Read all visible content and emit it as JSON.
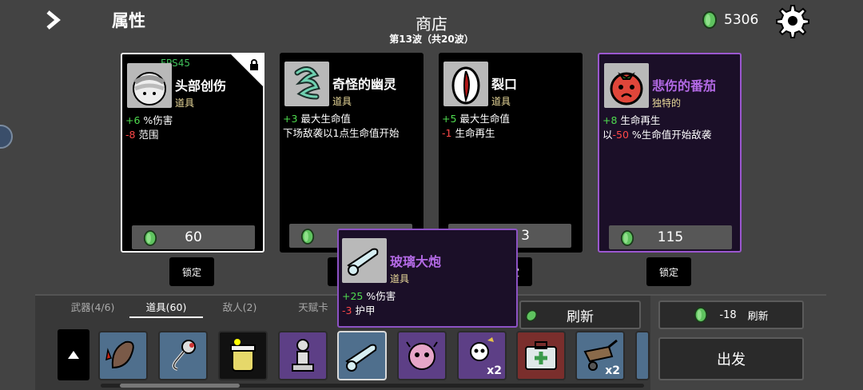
{
  "header": {
    "attributes_title": "属性",
    "shop_title": "商店",
    "wave_text": "第13波（共20波）",
    "money": "5306",
    "fps": "FPS45"
  },
  "colors": {
    "bg": "#434343",
    "positive": "#4fdc4f",
    "negative": "#ff4848",
    "legendary": "#b46ae6",
    "item_type": "#e9d99a",
    "coin": "#5fc35f"
  },
  "cards": [
    {
      "name": "头部创伤",
      "type": "道具",
      "icon": "bandaged-head-icon",
      "stat1_val": "+6",
      "stat1_text": "%伤害",
      "stat2_val": "-8",
      "stat2_text": "范围",
      "price": "60",
      "locked": true
    },
    {
      "name": "奇怪的幽灵",
      "type": "道具",
      "icon": "ghost-icon",
      "stat1_val": "+3",
      "stat1_text": "最大生命值",
      "stat2_text": "下场敌袭以1点生命值开始",
      "price": ""
    },
    {
      "name": "裂口",
      "type": "道具",
      "icon": "wound-mouth-icon",
      "stat1_val": "+5",
      "stat1_text": "最大生命值",
      "stat2_val": "-1",
      "stat2_text": "生命再生",
      "price": "3"
    },
    {
      "name": "悲伤的番茄",
      "type": "独特的",
      "icon": "sad-tomato-icon",
      "stat1_val": "+8",
      "stat1_text": "生命再生",
      "stat2_pre": "以",
      "stat2_val": "-50",
      "stat2_text": "%生命值开始敌袭",
      "price": "115"
    }
  ],
  "lock_label": "锁定",
  "tooltip": {
    "name": "玻璃大炮",
    "type": "道具",
    "icon": "glass-cannon-icon",
    "stat1_val": "+25",
    "stat1_text": "%伤害",
    "stat2_val": "-3",
    "stat2_text": "护甲"
  },
  "tabs": [
    {
      "label": "武器(4/6)",
      "active": false
    },
    {
      "label": "道具(60)",
      "active": true
    },
    {
      "label": "敌人(2)",
      "active": false
    },
    {
      "label": "天赋卡",
      "active": false
    }
  ],
  "inventory": [
    {
      "icon": "leech-icon",
      "qty": ""
    },
    {
      "icon": "fishing-hook-icon",
      "qty": ""
    },
    {
      "icon": "honey-jar-icon",
      "qty": ""
    },
    {
      "icon": "statue-icon",
      "qty": ""
    },
    {
      "icon": "glass-cannon-icon",
      "qty": ""
    },
    {
      "icon": "brain-creature-icon",
      "qty": ""
    },
    {
      "icon": "skull-creature-icon",
      "qty": "x2"
    },
    {
      "icon": "medkit-icon",
      "qty": ""
    },
    {
      "icon": "wheelbarrow-icon",
      "qty": "x2"
    }
  ],
  "actions": {
    "refresh_label": "刷新",
    "refresh_cost": "-18",
    "refresh_cost_label": "刷新",
    "go_label": "出发"
  }
}
